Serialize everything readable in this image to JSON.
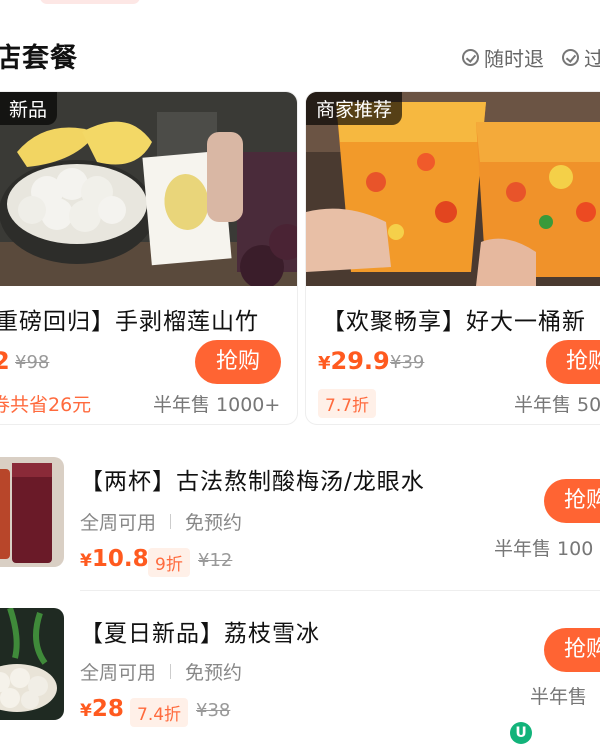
{
  "section": {
    "title": "店套餐",
    "guarantees": [
      "随时退",
      "过"
    ]
  },
  "cards": [
    {
      "tag": "新品",
      "title": "重磅回归】手剥榴莲山竹",
      "price": "2",
      "original": "¥98",
      "saving": "券共省26元",
      "button": "抢购",
      "sold": "半年售 1000+"
    },
    {
      "tag": "商家推荐",
      "title": "【欢聚畅享】好大一桶新",
      "price": "29.9",
      "original": "¥39",
      "discount": "7.7折",
      "button": "抢购",
      "sold": "半年售 50"
    }
  ],
  "rows": [
    {
      "title": "【两杯】古法熬制酸梅汤/龙眼水",
      "tags": [
        "全周可用",
        "免预约"
      ],
      "price": "10.8",
      "discount": "9折",
      "original": "¥12",
      "button": "抢购",
      "sold": "半年售 100"
    },
    {
      "title": "【夏日新品】荔枝雪冰",
      "tags": [
        "全周可用",
        "免预约"
      ],
      "price": "28",
      "discount": "7.4折",
      "original": "¥38",
      "button": "抢购",
      "sold": "半年售"
    }
  ],
  "currency": "¥",
  "colors": {
    "accent": "#ff6433",
    "price": "#ff5a1f"
  }
}
